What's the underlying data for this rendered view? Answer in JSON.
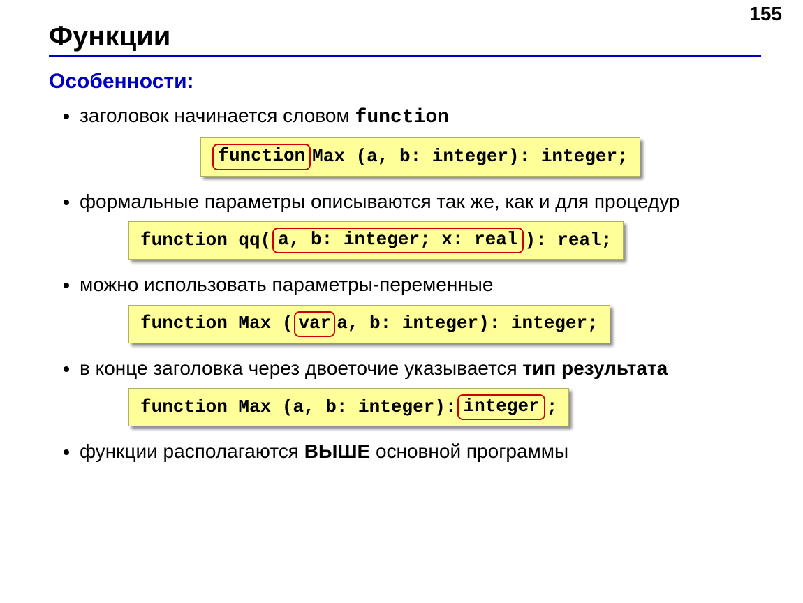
{
  "page_number": "155",
  "title": "Функции",
  "subhead": "Особенности:",
  "bullets": {
    "b1_pre": "заголовок начинается словом ",
    "b1_code": "function",
    "b2": "формальные параметры описываются так же, как и для процедур",
    "b3": "можно использовать параметры-переменные",
    "b4_pre": "в конце заголовка через двоеточие указывается ",
    "b4_bold": "тип результата",
    "b5_pre": "функции располагаются ",
    "b5_bold": "ВЫШЕ",
    "b5_post": " основной программы"
  },
  "code1": {
    "circled": "function",
    "rest": " Max (a, b: integer): integer;"
  },
  "code2": {
    "pre": "function qq( ",
    "circled": "a, b: integer; x: real",
    "post": " ): real;"
  },
  "code3": {
    "pre": "function Max ( ",
    "circled": "var",
    "post": " a, b: integer): integer;"
  },
  "code4": {
    "pre": "function Max (a, b: integer): ",
    "circled": "integer",
    "post": " ;"
  }
}
